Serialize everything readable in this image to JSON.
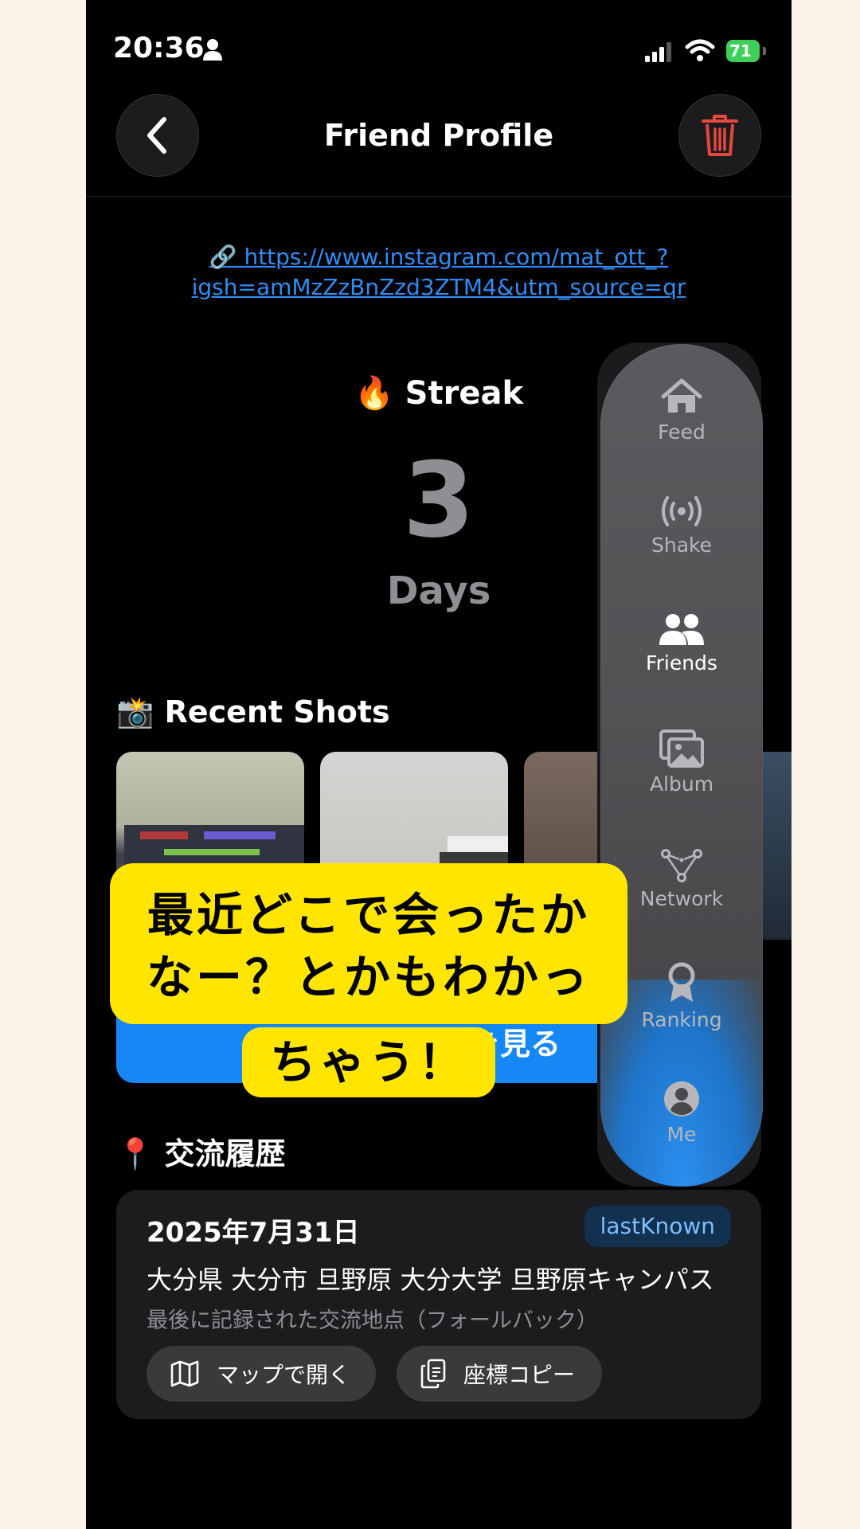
{
  "status_bar": {
    "time": "20:36",
    "battery": "71"
  },
  "header": {
    "title": "Friend Profile"
  },
  "link": {
    "line1": "🔗 https://www.instagram.com/mat_ott_?",
    "line2": "igsh=amMzZzBnZzd3ZTM4&utm_source=qr"
  },
  "streak": {
    "title": "🔥 Streak",
    "value": "3",
    "unit": "Days"
  },
  "recent": {
    "title": "📸 Recent Shots",
    "button_label": "を見る"
  },
  "history": {
    "title": "📍 交流履歴",
    "date": "2025年7月31日",
    "badge": "lastKnown",
    "address": "大分県 大分市 旦野原 大分大学 旦野原キャンパス",
    "note": "最後に記録された交流地点（フォールバック）",
    "open_map": "マップで開く",
    "copy_coords": "座標コピー"
  },
  "tabs": [
    {
      "label": "Feed",
      "icon": "house-icon"
    },
    {
      "label": "Shake",
      "icon": "broadcast-icon"
    },
    {
      "label": "Friends",
      "icon": "people-icon"
    },
    {
      "label": "Album",
      "icon": "photos-icon"
    },
    {
      "label": "Network",
      "icon": "network-icon"
    },
    {
      "label": "Ranking",
      "icon": "medal-icon"
    },
    {
      "label": "Me",
      "icon": "person-icon"
    }
  ],
  "active_tab": "Friends",
  "caption": {
    "line1": "最近どこで会ったか",
    "line2": "なー？とかもわかっ",
    "line3": "ちゃう！"
  },
  "colors": {
    "accent": "#1688f5",
    "trash": "#e5483c",
    "caption_bg": "#ffe500",
    "battery": "#3cd05a"
  }
}
